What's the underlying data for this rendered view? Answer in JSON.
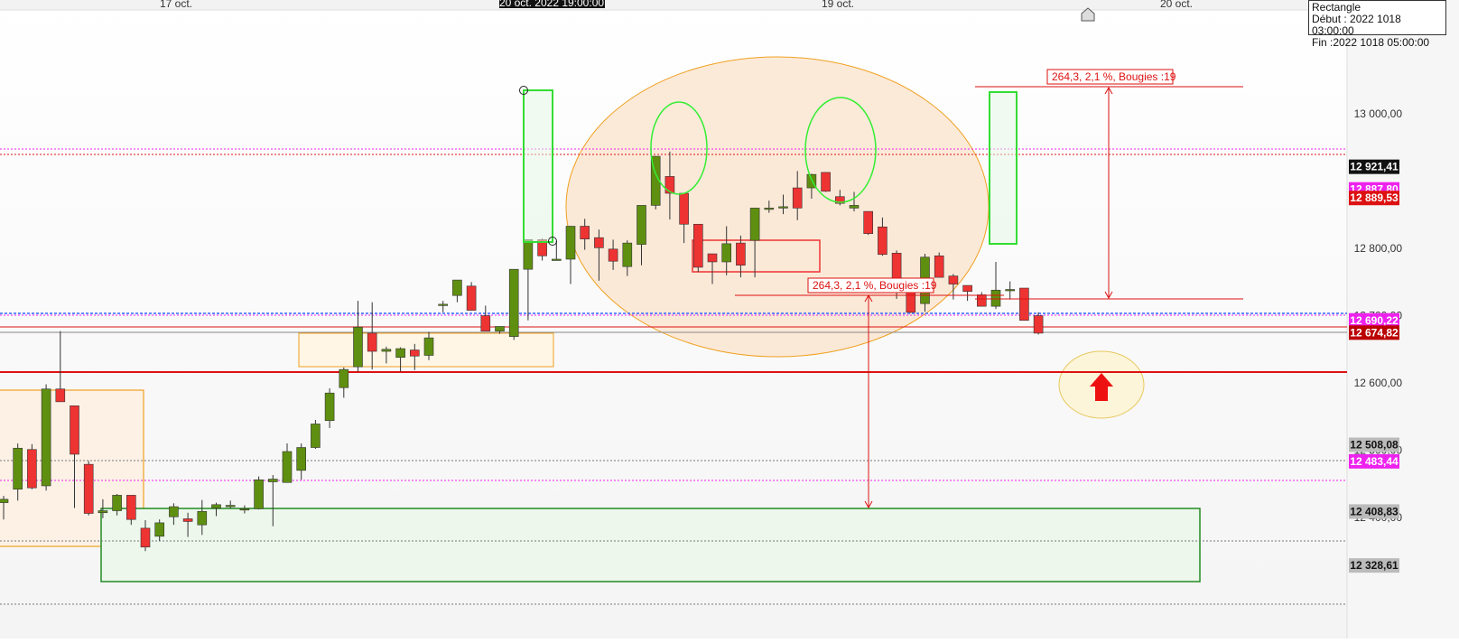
{
  "chart_data": {
    "type": "candlestick",
    "title": "",
    "ylim": [
      12310,
      13070
    ],
    "x_ticks": [
      "17 oct.",
      "19 oct.",
      "20 oct."
    ],
    "crosshair_time_label": "20 oct. 2022 19:00:00",
    "y_ticks": [
      "13 000,00",
      "12 800,00",
      "12 700,00",
      "12 600,00",
      "12 500,00",
      "12 400,00"
    ],
    "y_tick_values": [
      13000,
      12800,
      12700,
      12600,
      12500,
      12400
    ],
    "price_tags": [
      {
        "label": "12 921,41",
        "value": 12921.41,
        "bg": "#111111",
        "fg": "#ffffff"
      },
      {
        "label": "12 887,80",
        "value": 12887.8,
        "bg": "#ee22ee",
        "fg": "#ffffff"
      },
      {
        "label": "12 889,53",
        "value": 12875,
        "bg": "#dd1111",
        "fg": "#ffffff"
      },
      {
        "label": "12 690,22",
        "value": 12693,
        "bg": "#ee22ee",
        "fg": "#ffffff"
      },
      {
        "label": "12 674,82",
        "value": 12674.82,
        "bg": "#bb0000",
        "fg": "#ffffff"
      },
      {
        "label": "12 508,08",
        "value": 12508.08,
        "bg": "#bbbbbb",
        "fg": "#111111"
      },
      {
        "label": "12 483,44",
        "value": 12483.44,
        "bg": "#ee22ee",
        "fg": "#ffffff"
      },
      {
        "label": "12 408,83",
        "value": 12408.83,
        "bg": "#bbbbbb",
        "fg": "#111111"
      },
      {
        "label": "12 328,61",
        "value": 12328.61,
        "bg": "#bbbbbb",
        "fg": "#111111"
      }
    ],
    "candles": [
      {
        "o": 12422,
        "h": 12432,
        "l": 12397,
        "c": 12427
      },
      {
        "o": 12442,
        "h": 12510,
        "l": 12425,
        "c": 12503
      },
      {
        "o": 12501,
        "h": 12509,
        "l": 12442,
        "c": 12444
      },
      {
        "o": 12447,
        "h": 12598,
        "l": 12440,
        "c": 12591
      },
      {
        "o": 12591,
        "h": 12677,
        "l": 12578,
        "c": 12572
      },
      {
        "o": 12566,
        "h": 12566,
        "l": 12414,
        "c": 12494
      },
      {
        "o": 12479,
        "h": 12484,
        "l": 12403,
        "c": 12406
      },
      {
        "o": 12407,
        "h": 12427,
        "l": 12399,
        "c": 12410
      },
      {
        "o": 12410,
        "h": 12435,
        "l": 12403,
        "c": 12433
      },
      {
        "o": 12433,
        "h": 12432,
        "l": 12389,
        "c": 12397
      },
      {
        "o": 12384,
        "h": 12396,
        "l": 12350,
        "c": 12356
      },
      {
        "o": 12372,
        "h": 12397,
        "l": 12365,
        "c": 12392
      },
      {
        "o": 12401,
        "h": 12421,
        "l": 12389,
        "c": 12416
      },
      {
        "o": 12398,
        "h": 12407,
        "l": 12371,
        "c": 12394
      },
      {
        "o": 12389,
        "h": 12426,
        "l": 12374,
        "c": 12409
      },
      {
        "o": 12414,
        "h": 12422,
        "l": 12402,
        "c": 12419
      },
      {
        "o": 12417,
        "h": 12425,
        "l": 12414,
        "c": 12418
      },
      {
        "o": 12413,
        "h": 12418,
        "l": 12406,
        "c": 12413
      },
      {
        "o": 12413,
        "h": 12461,
        "l": 12412,
        "c": 12456
      },
      {
        "o": 12453,
        "h": 12463,
        "l": 12387,
        "c": 12457
      },
      {
        "o": 12452,
        "h": 12510,
        "l": 12454,
        "c": 12498
      },
      {
        "o": 12470,
        "h": 12510,
        "l": 12456,
        "c": 12504
      },
      {
        "o": 12504,
        "h": 12545,
        "l": 12502,
        "c": 12539
      },
      {
        "o": 12544,
        "h": 12592,
        "l": 12533,
        "c": 12585
      },
      {
        "o": 12593,
        "h": 12623,
        "l": 12578,
        "c": 12620
      },
      {
        "o": 12624,
        "h": 12722,
        "l": 12617,
        "c": 12683
      },
      {
        "o": 12674,
        "h": 12720,
        "l": 12620,
        "c": 12647
      },
      {
        "o": 12647,
        "h": 12654,
        "l": 12629,
        "c": 12650
      },
      {
        "o": 12638,
        "h": 12653,
        "l": 12617,
        "c": 12651
      },
      {
        "o": 12649,
        "h": 12658,
        "l": 12619,
        "c": 12640
      },
      {
        "o": 12641,
        "h": 12676,
        "l": 12634,
        "c": 12667
      },
      {
        "o": 12715,
        "h": 12722,
        "l": 12705,
        "c": 12717
      },
      {
        "o": 12730,
        "h": 12749,
        "l": 12720,
        "c": 12753
      },
      {
        "o": 12744,
        "h": 12750,
        "l": 12709,
        "c": 12708
      },
      {
        "o": 12700,
        "h": 12715,
        "l": 12697,
        "c": 12677
      },
      {
        "o": 12677,
        "h": 12674,
        "l": 12673,
        "c": 12684
      },
      {
        "o": 12669,
        "h": 12735,
        "l": 12664,
        "c": 12769
      },
      {
        "o": 12769,
        "h": 12785,
        "l": 12693,
        "c": 12813
      },
      {
        "o": 12813,
        "h": 12815,
        "l": 12782,
        "c": 12789
      },
      {
        "o": 12783,
        "h": 12811,
        "l": 12788,
        "c": 12784
      },
      {
        "o": 12784,
        "h": 12823,
        "l": 12747,
        "c": 12833
      },
      {
        "o": 12833,
        "h": 12844,
        "l": 12798,
        "c": 12814
      },
      {
        "o": 12816,
        "h": 12828,
        "l": 12752,
        "c": 12801
      },
      {
        "o": 12799,
        "h": 12813,
        "l": 12768,
        "c": 12781
      },
      {
        "o": 12773,
        "h": 12812,
        "l": 12759,
        "c": 12808
      },
      {
        "o": 12806,
        "h": 12840,
        "l": 12775,
        "c": 12864
      },
      {
        "o": 12864,
        "h": 12935,
        "l": 12858,
        "c": 12937
      },
      {
        "o": 12907,
        "h": 12944,
        "l": 12843,
        "c": 12882
      },
      {
        "o": 12882,
        "h": 12874,
        "l": 12808,
        "c": 12836
      },
      {
        "o": 12836,
        "h": 12828,
        "l": 12765,
        "c": 12772
      },
      {
        "o": 12792,
        "h": 12787,
        "l": 12747,
        "c": 12780
      },
      {
        "o": 12780,
        "h": 12833,
        "l": 12760,
        "c": 12807
      },
      {
        "o": 12808,
        "h": 12819,
        "l": 12757,
        "c": 12775
      },
      {
        "o": 12812,
        "h": 12837,
        "l": 12757,
        "c": 12860
      },
      {
        "o": 12858,
        "h": 12871,
        "l": 12853,
        "c": 12860
      },
      {
        "o": 12860,
        "h": 12880,
        "l": 12851,
        "c": 12862
      },
      {
        "o": 12890,
        "h": 12915,
        "l": 12842,
        "c": 12860
      },
      {
        "o": 12890,
        "h": 12911,
        "l": 12874,
        "c": 12910
      },
      {
        "o": 12913,
        "h": 12912,
        "l": 12884,
        "c": 12885
      },
      {
        "o": 12877,
        "h": 12887,
        "l": 12864,
        "c": 12867
      },
      {
        "o": 12860,
        "h": 12884,
        "l": 12855,
        "c": 12864
      },
      {
        "o": 12855,
        "h": 12852,
        "l": 12820,
        "c": 12822
      },
      {
        "o": 12832,
        "h": 12846,
        "l": 12789,
        "c": 12791
      },
      {
        "o": 12793,
        "h": 12797,
        "l": 12725,
        "c": 12743
      },
      {
        "o": 12745,
        "h": 12722,
        "l": 12704,
        "c": 12705
      },
      {
        "o": 12718,
        "h": 12792,
        "l": 12706,
        "c": 12787
      },
      {
        "o": 12789,
        "h": 12794,
        "l": 12759,
        "c": 12757
      },
      {
        "o": 12759,
        "h": 12762,
        "l": 12724,
        "c": 12747
      },
      {
        "o": 12745,
        "h": 12741,
        "l": 12722,
        "c": 12736
      },
      {
        "o": 12731,
        "h": 12735,
        "l": 12718,
        "c": 12714
      },
      {
        "o": 12714,
        "h": 12780,
        "l": 12710,
        "c": 12738
      },
      {
        "o": 12738,
        "h": 12751,
        "l": 12724,
        "c": 12739
      },
      {
        "o": 12741,
        "h": 12740,
        "l": 12693,
        "c": 12693
      },
      {
        "o": 12700,
        "h": 12705,
        "l": 12672,
        "c": 12674
      }
    ]
  },
  "annotations": {
    "measure_label_top": "264,3, 2,1 %, Bougies :19",
    "measure_label_mid": "264,3, 2,1 %, Bougies :19"
  },
  "tooltip": {
    "line1": "Rectangle",
    "line2": "Début : 2022 1018 03:00:00",
    "line3": "Fin :2022 1018 05:00:00"
  },
  "colors": {
    "bull": "#5f8f10",
    "bear": "#ee3333",
    "magenta_line": "#ee22ee",
    "blue_line": "#3366ff",
    "red_line": "#dd1111"
  }
}
